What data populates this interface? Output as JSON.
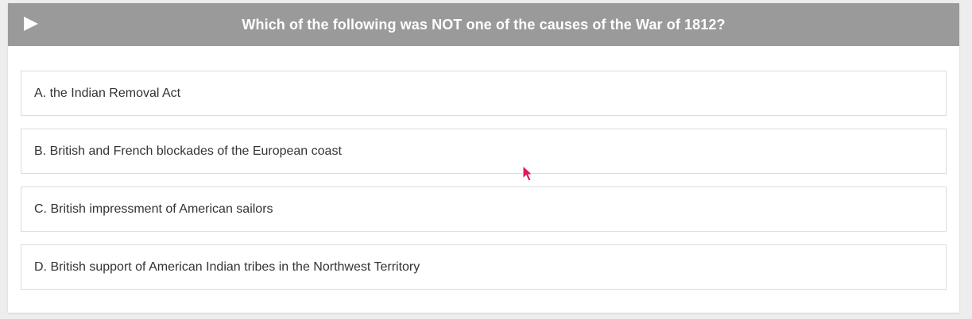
{
  "quiz": {
    "question": "Which of the following was NOT one of the causes of the War of 1812?",
    "play_icon": "play-icon",
    "options": [
      {
        "label": "A. the Indian Removal Act"
      },
      {
        "label": "B. British and French blockades of the European coast"
      },
      {
        "label": "C. British impressment of American sailors"
      },
      {
        "label": "D. British support of American Indian tribes in the Northwest Territory"
      }
    ]
  },
  "colors": {
    "header_bg": "#9a9a9a",
    "cursor": "#e0185a"
  }
}
